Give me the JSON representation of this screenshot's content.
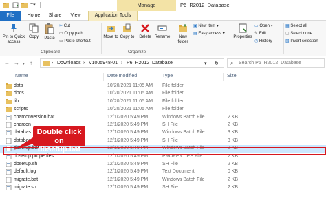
{
  "window": {
    "manage_tab": "Manage",
    "title": "P6_R2012_Database"
  },
  "tabs": {
    "file": "File",
    "home": "Home",
    "share": "Share",
    "view": "View",
    "app_tools": "Application Tools"
  },
  "ribbon": {
    "pin": "Pin to Quick access",
    "copy": "Copy",
    "paste": "Paste",
    "cut": "Cut",
    "copy_path": "Copy path",
    "paste_shortcut": "Paste shortcut",
    "clipboard": "Clipboard",
    "move_to": "Move to",
    "copy_to": "Copy to",
    "delete": "Delete",
    "rename": "Rename",
    "organize": "Organize",
    "new_folder": "New folder",
    "new_item": "New item",
    "easy_access": "Easy access",
    "properties": "Properties",
    "open": "Open",
    "edit": "Edit",
    "history": "History",
    "select_all": "Select all",
    "select_none": "Select none",
    "invert_selection": "Invert selection"
  },
  "address": {
    "sep": "›",
    "crumbs": [
      "Downloads",
      "V1005948-01",
      "P6_R2012_Database"
    ],
    "search_placeholder": "Search P6_R2012_Database"
  },
  "columns": {
    "name": "Name",
    "date": "Date modified",
    "type": "Type",
    "size": "Size"
  },
  "files": [
    {
      "name": "data",
      "date": "10/20/2021 11:05 AM",
      "type": "File folder",
      "size": "",
      "kind": "folder"
    },
    {
      "name": "docs",
      "date": "10/20/2021 11:05 AM",
      "type": "File folder",
      "size": "",
      "kind": "folder"
    },
    {
      "name": "lib",
      "date": "10/20/2021 11:05 AM",
      "type": "File folder",
      "size": "",
      "kind": "folder"
    },
    {
      "name": "scripts",
      "date": "10/20/2021 11:05 AM",
      "type": "File folder",
      "size": "",
      "kind": "folder"
    },
    {
      "name": "charconversion.bat",
      "date": "12/1/2020 5:49 PM",
      "type": "Windows Batch File",
      "size": "2 KB",
      "kind": "file"
    },
    {
      "name": "charcon",
      "date": "12/1/2020 5:49 PM",
      "type": "SH File",
      "size": "2 KB",
      "kind": "file"
    },
    {
      "name": "databas",
      "date": "12/1/2020 5:49 PM",
      "type": "Windows Batch File",
      "size": "3 KB",
      "kind": "file"
    },
    {
      "name": "databas",
      "date": "12/1/2020 5:49 PM",
      "type": "SH File",
      "size": "3 KB",
      "kind": "file"
    },
    {
      "name": "dbsetup.bat",
      "date": "12/1/2020 5:49 PM",
      "type": "Windows Batch File",
      "size": "2 KB",
      "kind": "file"
    },
    {
      "name": "dbsetup.properties",
      "date": "12/1/2020 5:49 PM",
      "type": "PROPERTIES File",
      "size": "2 KB",
      "kind": "file"
    },
    {
      "name": "dbsetup.sh",
      "date": "12/1/2020 5:49 PM",
      "type": "SH File",
      "size": "2 KB",
      "kind": "file"
    },
    {
      "name": "default.log",
      "date": "12/1/2020 5:49 PM",
      "type": "Text Document",
      "size": "0 KB",
      "kind": "file"
    },
    {
      "name": "migrate.bat",
      "date": "12/1/2020 5:49 PM",
      "type": "Windows Batch File",
      "size": "2 KB",
      "kind": "file"
    },
    {
      "name": "migrate.sh",
      "date": "12/1/2020 5:49 PM",
      "type": "SH File",
      "size": "2 KB",
      "kind": "file"
    }
  ],
  "callout": {
    "line1": "Double click",
    "line2": "on dbsetup.bat"
  },
  "colors": {
    "accent": "#1f6fc4",
    "folder": "#e8c160",
    "selected_row": "#cce8ff",
    "callout": "#d7181f",
    "manage_tab": "#f3e3a6"
  }
}
